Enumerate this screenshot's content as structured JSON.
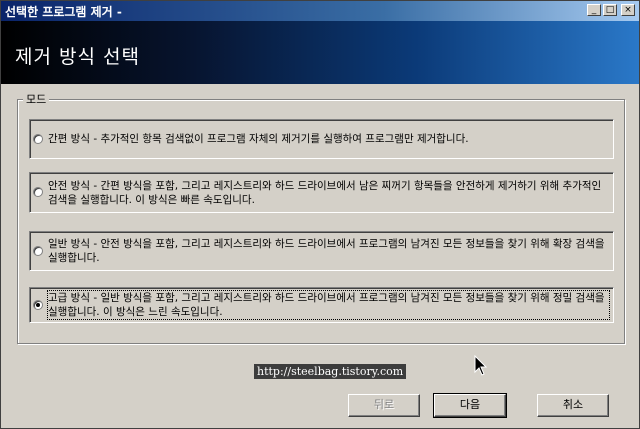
{
  "window": {
    "title": "선택한 프로그램 제거 -",
    "controls": {
      "minimize": "_",
      "maximize": "□",
      "close": "×"
    }
  },
  "header": {
    "title": "제거 방식 선택"
  },
  "mode_group": {
    "label": "모드",
    "options": [
      {
        "label": "간편 방식 - 추가적인 항목 검색없이 프로그램 자체의 제거기를 실행하여 프로그램만 제거합니다.",
        "selected": false
      },
      {
        "label": "안전 방식 - 간편 방식을 포함, 그리고 레지스트리와 하드 드라이브에서 남은 찌꺼기 항목들을 안전하게 제거하기 위해 추가적인 검색을 실행합니다. 이 방식은 빠른 속도입니다.",
        "selected": false
      },
      {
        "label": "일반 방식 - 안전 방식을 포함, 그리고 레지스트리와 하드 드라이브에서 프로그램의 남겨진 모든 정보들을 찾기 위해 확장 검색을 실행합니다.",
        "selected": false
      },
      {
        "label": "고급 방식 - 일반 방식을 포함, 그리고 레지스트리와 하드 드라이브에서 프로그램의 남겨진 모든 정보들을 찾기 위해 정밀 검색을 실행합니다. 이 방식은 느린 속도입니다.",
        "selected": true
      }
    ]
  },
  "watermark": "http://steelbag.tistory.com",
  "buttons": {
    "back": "뒤로",
    "next": "다음",
    "cancel": "취소"
  }
}
